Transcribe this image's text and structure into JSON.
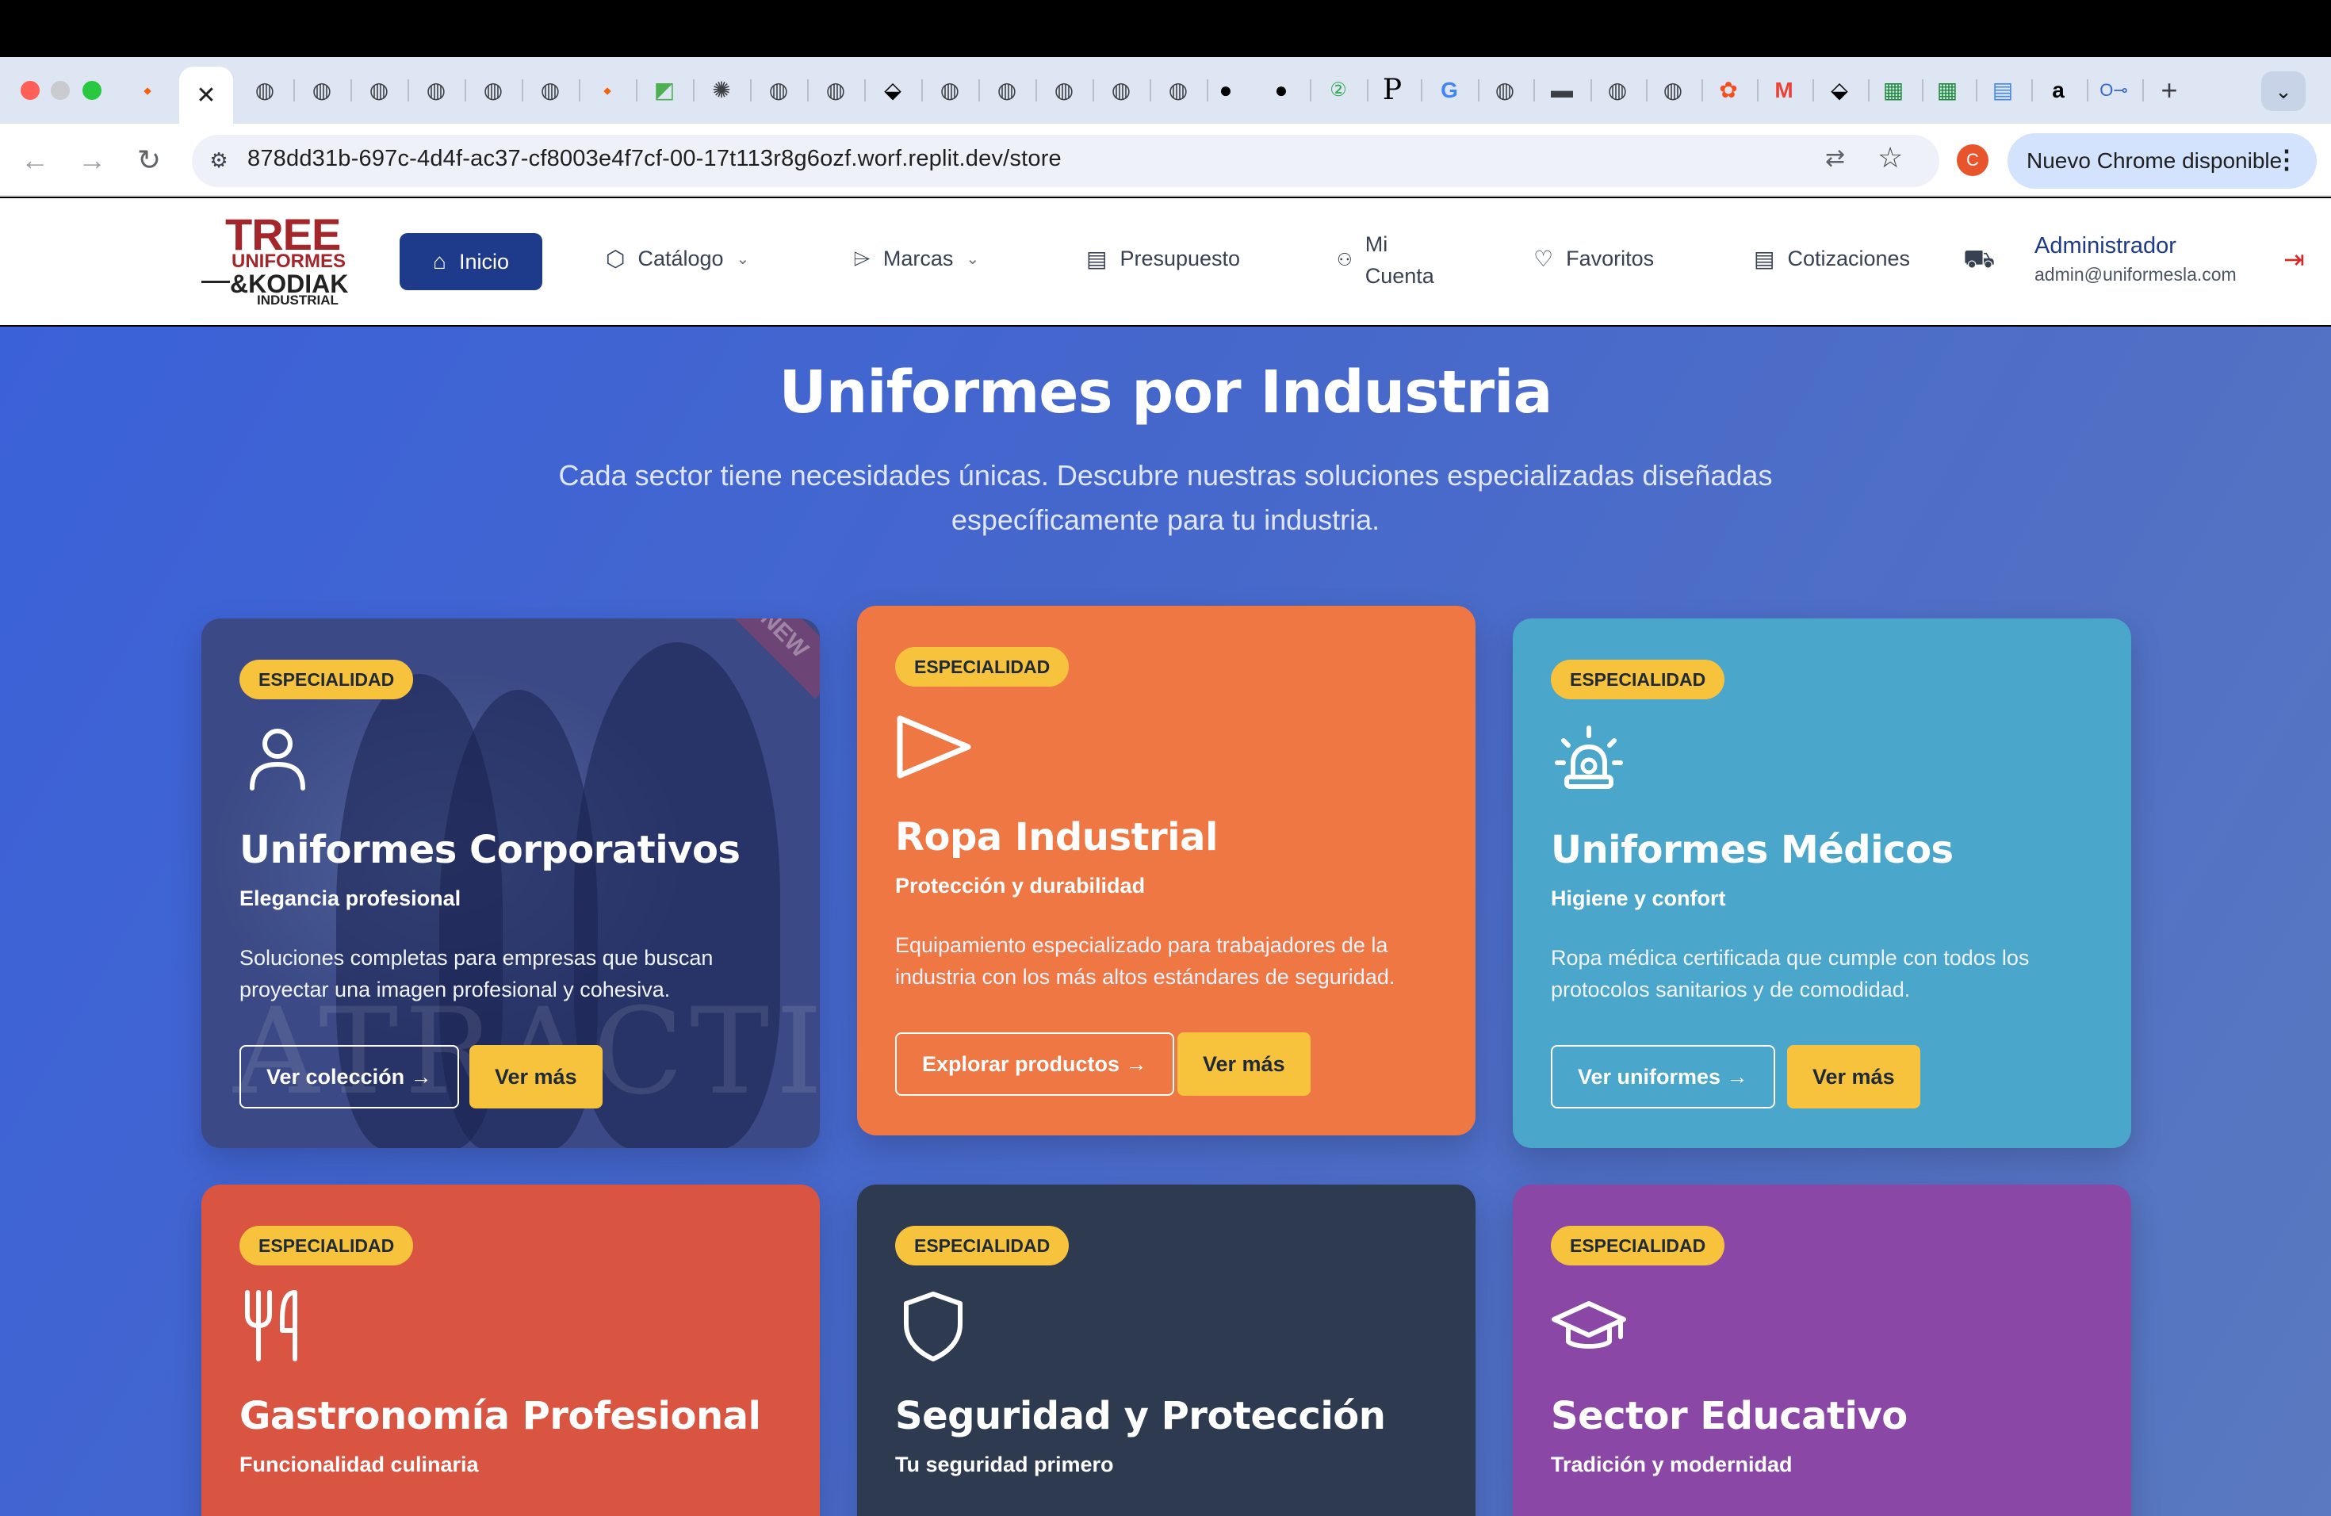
{
  "browser": {
    "url": "878dd31b-697c-4d4f-ac37-cf8003e4f7cf-00-17t113r8g6ozf.worf.replit.dev/store",
    "update_chip": "Nuevo Chrome disponible",
    "profile_initial": "C",
    "active_tab_close": "✕",
    "new_tab": "+",
    "tabs_icons": [
      "replit-icon",
      "globe-icon",
      "globe-icon",
      "globe-icon",
      "globe-icon",
      "globe-icon",
      "globe-icon",
      "replit-icon",
      "figma-icon",
      "openai-icon",
      "globe-icon",
      "globe-icon",
      "link-icon",
      "globe-icon",
      "globe-icon",
      "globe-icon",
      "globe-icon",
      "github-icon",
      "github-icon",
      "counter-icon",
      "p-icon",
      "google-icon",
      "globe-icon",
      "stripe-icon",
      "globe-icon",
      "globe-icon",
      "figma-icon",
      "gmail-icon",
      "link-icon",
      "sheets-icon",
      "sheets-icon",
      "docs-icon",
      "amazon-icon",
      "key-icon"
    ]
  },
  "header": {
    "logo": {
      "line1": "TREE",
      "line2": "UNIFORMES",
      "line3": "&KODIAK",
      "line4": "INDUSTRIAL"
    },
    "nav": {
      "inicio": "Inicio",
      "catalogo": "Catálogo",
      "marcas": "Marcas",
      "presupuesto": "Presupuesto",
      "mi_cuenta_1": "Mi",
      "mi_cuenta_2": "Cuenta",
      "favoritos": "Favoritos",
      "cotizaciones": "Cotizaciones"
    },
    "user": {
      "name": "Administrador",
      "email": "admin@uniformesla.com"
    }
  },
  "hero": {
    "title": "Uniformes por Industria",
    "subtitle": "Cada sector tiene necesidades únicas. Descubre nuestras soluciones especializadas diseñadas específicamente para tu industria."
  },
  "cards": [
    {
      "badge": "ESPECIALIDAD",
      "icon": "user-icon",
      "title": "Uniformes Corporativos",
      "subtitle": "Elegancia profesional",
      "description": "Soluciones completas para empresas que buscan proyectar una imagen profesional y cohesiva.",
      "primary_button": "Ver colección →",
      "secondary_button": "Ver más",
      "color": "#3b4a86",
      "image_watermark": "ATRACTIVE"
    },
    {
      "badge": "ESPECIALIDAD",
      "icon": "play-icon",
      "title": "Ropa Industrial",
      "subtitle": "Protección y durabilidad",
      "description": "Equipamiento especializado para trabajadores de la industria con los más altos estándares de seguridad.",
      "primary_button": "Explorar productos →",
      "secondary_button": "Ver más",
      "color": "#ee7744"
    },
    {
      "badge": "ESPECIALIDAD",
      "icon": "siren-icon",
      "title": "Uniformes Médicos",
      "subtitle": "Higiene y confort",
      "description": "Ropa médica certificada que cumple con todos los protocolos sanitarios y de comodidad.",
      "primary_button": "Ver uniformes →",
      "secondary_button": "Ver más",
      "color": "#4aa6cb"
    },
    {
      "badge": "ESPECIALIDAD",
      "icon": "utensils-icon",
      "title": "Gastronomía Profesional",
      "subtitle": "Funcionalidad culinaria",
      "color": "#d95441"
    },
    {
      "badge": "ESPECIALIDAD",
      "icon": "shield-icon",
      "title": "Seguridad y Protección",
      "subtitle": "Tu seguridad primero",
      "color": "#2e3a50"
    },
    {
      "badge": "ESPECIALIDAD",
      "icon": "graduation-cap-icon",
      "title": "Sector Educativo",
      "subtitle": "Tradición y modernidad",
      "color": "#8a47a6"
    }
  ]
}
